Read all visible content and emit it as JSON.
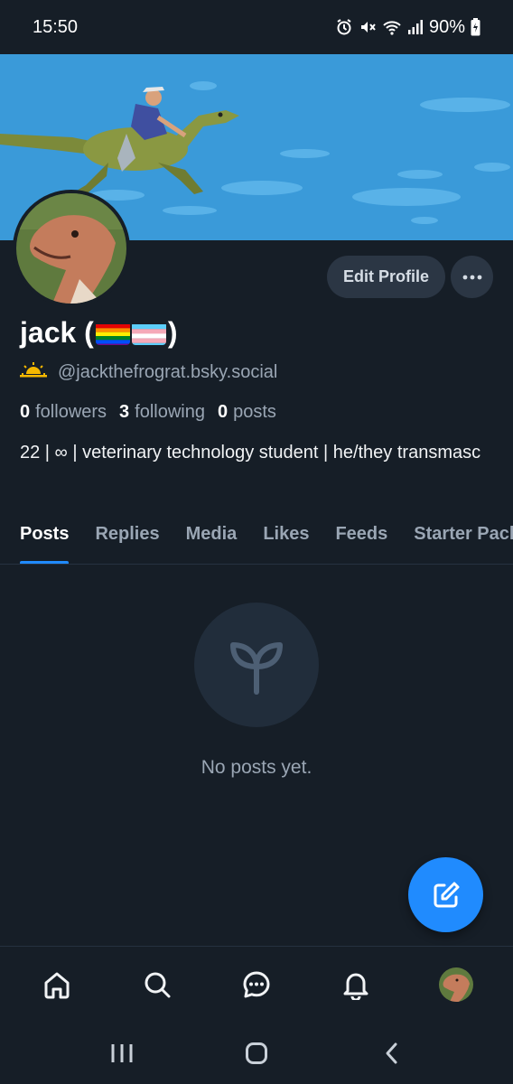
{
  "status_bar": {
    "time": "15:50",
    "battery": "90%",
    "icons": [
      "alarm-icon",
      "mute-icon",
      "wifi-icon",
      "signal-icon",
      "battery-icon"
    ]
  },
  "profile": {
    "edit_label": "Edit Profile",
    "more_icon": "ellipsis-icon",
    "display_name_prefix": "jack (",
    "display_name_suffix": ")",
    "handle": "@jackthefrograt.bsky.social",
    "followers_count": "0",
    "followers_label": "followers",
    "following_count": "3",
    "following_label": "following",
    "posts_count": "0",
    "posts_label": "posts",
    "bio": "22 | ∞ | veterinary technology student | he/they transmasc"
  },
  "tabs": [
    {
      "label": "Posts",
      "active": true
    },
    {
      "label": "Replies",
      "active": false
    },
    {
      "label": "Media",
      "active": false
    },
    {
      "label": "Likes",
      "active": false
    },
    {
      "label": "Feeds",
      "active": false
    },
    {
      "label": "Starter Packs",
      "active": false
    }
  ],
  "empty_state": {
    "icon": "sprout-icon",
    "text": "No posts yet."
  },
  "fab_icon": "compose-icon",
  "bottom_nav": [
    "home-icon",
    "search-icon",
    "chat-icon",
    "bell-icon",
    "profile-avatar"
  ],
  "system_nav": [
    "recents-icon",
    "home-circle-icon",
    "back-icon"
  ],
  "colors": {
    "background": "#161e27",
    "accent": "#208bfe",
    "muted_text": "#9aa6b4",
    "button_bg": "#2b3644"
  }
}
